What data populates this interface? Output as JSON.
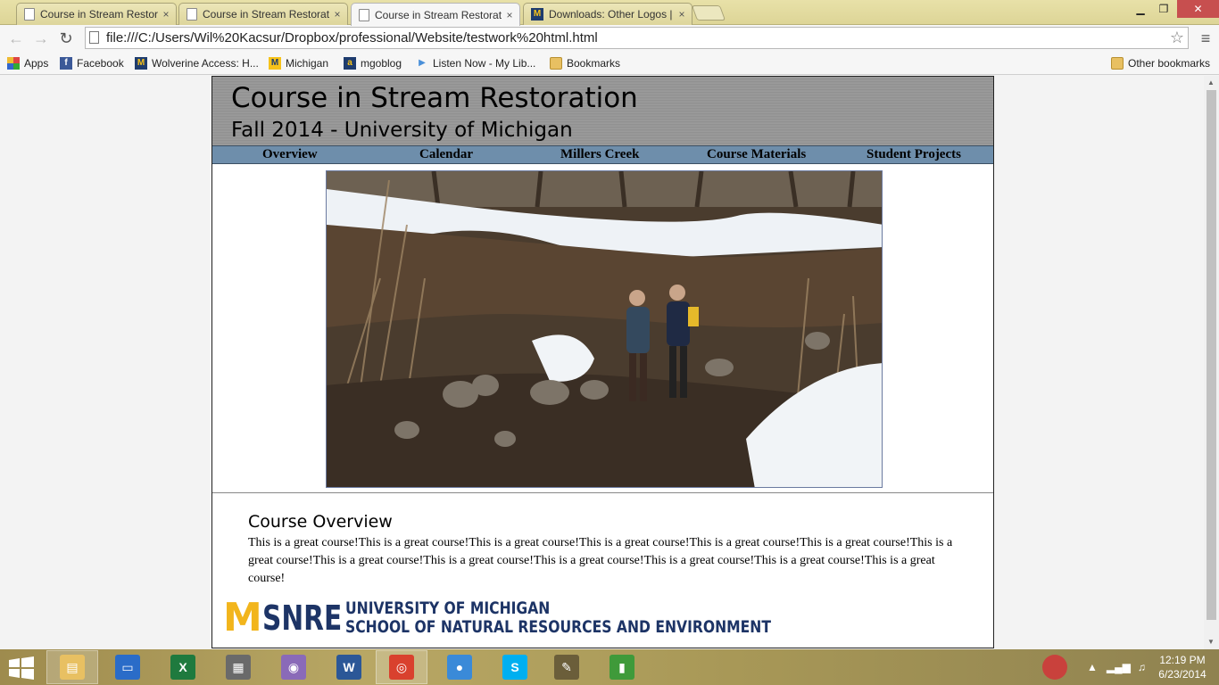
{
  "browser": {
    "tabs": [
      {
        "title": "Course in Stream Restorat",
        "icon": "document-icon",
        "active": false
      },
      {
        "title": "Course in Stream Restorat",
        "icon": "document-icon",
        "active": false
      },
      {
        "title": "Course in Stream Restorat",
        "icon": "document-icon",
        "active": true
      },
      {
        "title": "Downloads: Other Logos |",
        "icon": "michigan-m-icon",
        "active": false
      }
    ],
    "close_glyph": "×",
    "url": "file:///C:/Users/Wil%20Kacsur/Dropbox/professional/Website/testwork%20html.html",
    "bookmarks": [
      {
        "label": "Apps",
        "icon": "apps-icon"
      },
      {
        "label": "Facebook",
        "icon": "facebook-icon"
      },
      {
        "label": "Wolverine Access: H...",
        "icon": "michigan-m-icon"
      },
      {
        "label": "Michigan",
        "icon": "michigan-m-icon"
      },
      {
        "label": "mgoblog",
        "icon": "mgoblog-icon"
      },
      {
        "label": "Listen Now - My Lib...",
        "icon": "play-icon"
      },
      {
        "label": "Bookmarks",
        "icon": "folder-icon"
      }
    ],
    "other_bookmarks": "Other bookmarks"
  },
  "site": {
    "title": "Course in Stream Restoration",
    "subtitle": "Fall 2014 - University of Michigan",
    "nav": [
      "Overview",
      "Calendar",
      "Millers Creek",
      "Course Materials",
      "Student Projects"
    ],
    "overview_heading": "Course Overview",
    "overview_text": "This is a great course!This is a great course!This is a great course!This is a great course!This is a great course!This is a great course!This is a great course!This is a great course!This is a great course!This is a great course!This is a great course!This is a great course!This is a great course!",
    "logo": {
      "mark": "M",
      "acronym": "SNRE",
      "line1": "UNIVERSITY OF MICHIGAN",
      "line2": "SCHOOL OF NATURAL RESOURCES AND ENVIRONMENT",
      "colors": {
        "maize": "#f2b51c",
        "blue": "#1d3466"
      }
    }
  },
  "taskbar": {
    "apps": [
      {
        "name": "file-explorer-icon",
        "glyph": "▤",
        "color": "#e8c062"
      },
      {
        "name": "lenovo-icon",
        "glyph": "▭",
        "color": "#2a6cc8"
      },
      {
        "name": "excel-icon",
        "glyph": "X",
        "color": "#1f7a3e"
      },
      {
        "name": "calculator-icon",
        "glyph": "▦",
        "color": "#6a6a6a"
      },
      {
        "name": "paint-icon",
        "glyph": "◉",
        "color": "#8a6ab8"
      },
      {
        "name": "word-icon",
        "glyph": "W",
        "color": "#2b5797"
      },
      {
        "name": "chrome-icon",
        "glyph": "◎",
        "color": "#d9412e"
      },
      {
        "name": "app-icon",
        "glyph": "●",
        "color": "#3a8ad8"
      },
      {
        "name": "skype-icon",
        "glyph": "S",
        "color": "#00aff0"
      },
      {
        "name": "gimp-icon",
        "glyph": "✎",
        "color": "#6b5e3a"
      },
      {
        "name": "project-icon",
        "glyph": "▮",
        "color": "#3f9a3a"
      }
    ],
    "time": "12:19 PM",
    "date": "6/23/2014"
  }
}
